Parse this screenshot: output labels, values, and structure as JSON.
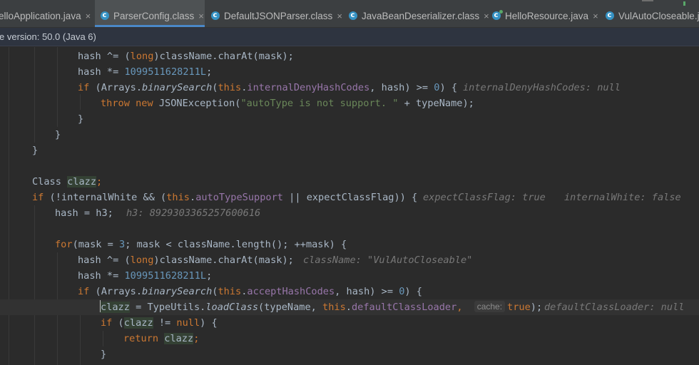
{
  "tabs": [
    {
      "label": "elloApplication.java",
      "icon": "none",
      "active": false
    },
    {
      "label": "ParserConfig.class",
      "icon": "class-icon",
      "active": true
    },
    {
      "label": "DefaultJSONParser.class",
      "icon": "class-icon",
      "active": false
    },
    {
      "label": "JavaBeanDeserializer.class",
      "icon": "class-icon",
      "active": false
    },
    {
      "label": "HelloResource.java",
      "icon": "class-icon",
      "active": false
    },
    {
      "label": "VulAutoCloseable.ja",
      "icon": "class-icon",
      "active": false
    }
  ],
  "tab_close_glyph": "×",
  "banner_text": "e version: 50.0 (Java 6)",
  "colors": {
    "keyword": "#cc7832",
    "number": "#6897bb",
    "string": "#6a8759",
    "field": "#9876aa",
    "text": "#a9b7c6",
    "hint": "#787878",
    "accent": "#4a88c7"
  },
  "code": {
    "l1": [
      "hash ^= (",
      "long",
      ")className.charAt(mask);"
    ],
    "l2": [
      "hash *= ",
      "1099511628211L",
      ";"
    ],
    "l3": [
      "if",
      " (Arrays.",
      "binarySearch",
      "(",
      "this",
      ".",
      "internalDenyHashCodes",
      ", hash) >= ",
      "0",
      ") {",
      "internalDenyHashCodes: null"
    ],
    "l4": [
      "throw new",
      " JSONException(",
      "\"autoType is not support. \"",
      " + typeName);"
    ],
    "l5": "}",
    "l6": "}",
    "l7": "}",
    "l8": [
      "Class ",
      "clazz",
      ";"
    ],
    "l9": [
      "if",
      " (!internalWhite && (",
      "this",
      ".",
      "autoTypeSupport",
      " || expectClassFlag)) {",
      "expectClassFlag: true",
      "internalWhite: false"
    ],
    "l10": [
      "hash = h3;",
      "h3: 8929303365257600616"
    ],
    "l11": [
      "for",
      "(mask = ",
      "3",
      "; mask < className.length(); ++mask) {"
    ],
    "l12": [
      "hash ^= (",
      "long",
      ")className.charAt(mask);",
      "className: \"VulAutoCloseable\""
    ],
    "l13": [
      "hash *= ",
      "1099511628211L",
      ";"
    ],
    "l14": [
      "if",
      " (Arrays.",
      "binarySearch",
      "(",
      "this",
      ".",
      "acceptHashCodes",
      ", hash) >= ",
      "0",
      ") {"
    ],
    "l15": [
      "c",
      "lazz",
      " = TypeUtils.",
      "loadClass",
      "(typeName, ",
      "this",
      ".",
      "defaultClassLoader",
      ", ",
      "cache:",
      "true",
      ");",
      "defaultClassLoader: null"
    ],
    "l16": [
      "if",
      " (",
      "clazz",
      " != ",
      "null",
      ") {"
    ],
    "l17": [
      "return ",
      "clazz",
      ";"
    ],
    "l18": "}"
  }
}
